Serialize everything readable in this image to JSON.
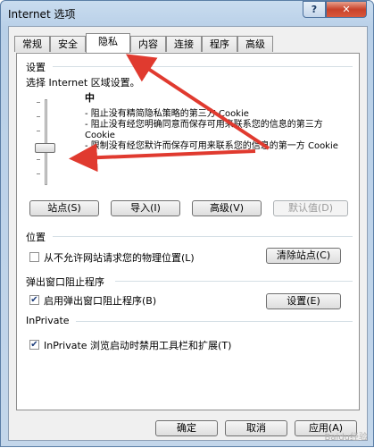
{
  "window": {
    "title": "Internet 选项",
    "help_label": "?",
    "close_label": "✕"
  },
  "tabs": [
    {
      "label": "常规"
    },
    {
      "label": "安全"
    },
    {
      "label": "隐私"
    },
    {
      "label": "内容"
    },
    {
      "label": "连接"
    },
    {
      "label": "程序"
    },
    {
      "label": "高级"
    }
  ],
  "settings": {
    "heading": "设置",
    "instruction": "选择 Internet 区域设置。",
    "level_name": "中",
    "slider_level_fraction": 0.5,
    "descriptions": [
      "- 阻止没有精简隐私策略的第三方 Cookie",
      "- 阻止没有经您明确同意而保存可用来联系您的信息的第三方 Cookie",
      "- 限制没有经您默许而保存可用来联系您的信息的第一方 Cookie"
    ],
    "buttons": {
      "sites": "站点(S)",
      "import": "导入(I)",
      "advanced": "高级(V)",
      "default": "默认值(D)"
    }
  },
  "location": {
    "heading": "位置",
    "checkbox_label": "从不允许网站请求您的物理位置(L)",
    "checked": false,
    "clear_button": "清除站点(C)"
  },
  "popup": {
    "heading": "弹出窗口阻止程序",
    "checkbox_label": "启用弹出窗口阻止程序(B)",
    "checked": true,
    "settings_button": "设置(E)"
  },
  "inprivate": {
    "heading": "InPrivate",
    "checkbox_label": "InPrivate 浏览启动时禁用工具栏和扩展(T)",
    "checked": true
  },
  "footer": {
    "ok": "确定",
    "cancel": "取消",
    "apply": "应用(A)"
  },
  "watermark": "Baidu经验",
  "colors": {
    "annotation_arrow": "#e03a2f",
    "title_bar": "#b9d0e8",
    "close_button": "#c8422a"
  }
}
